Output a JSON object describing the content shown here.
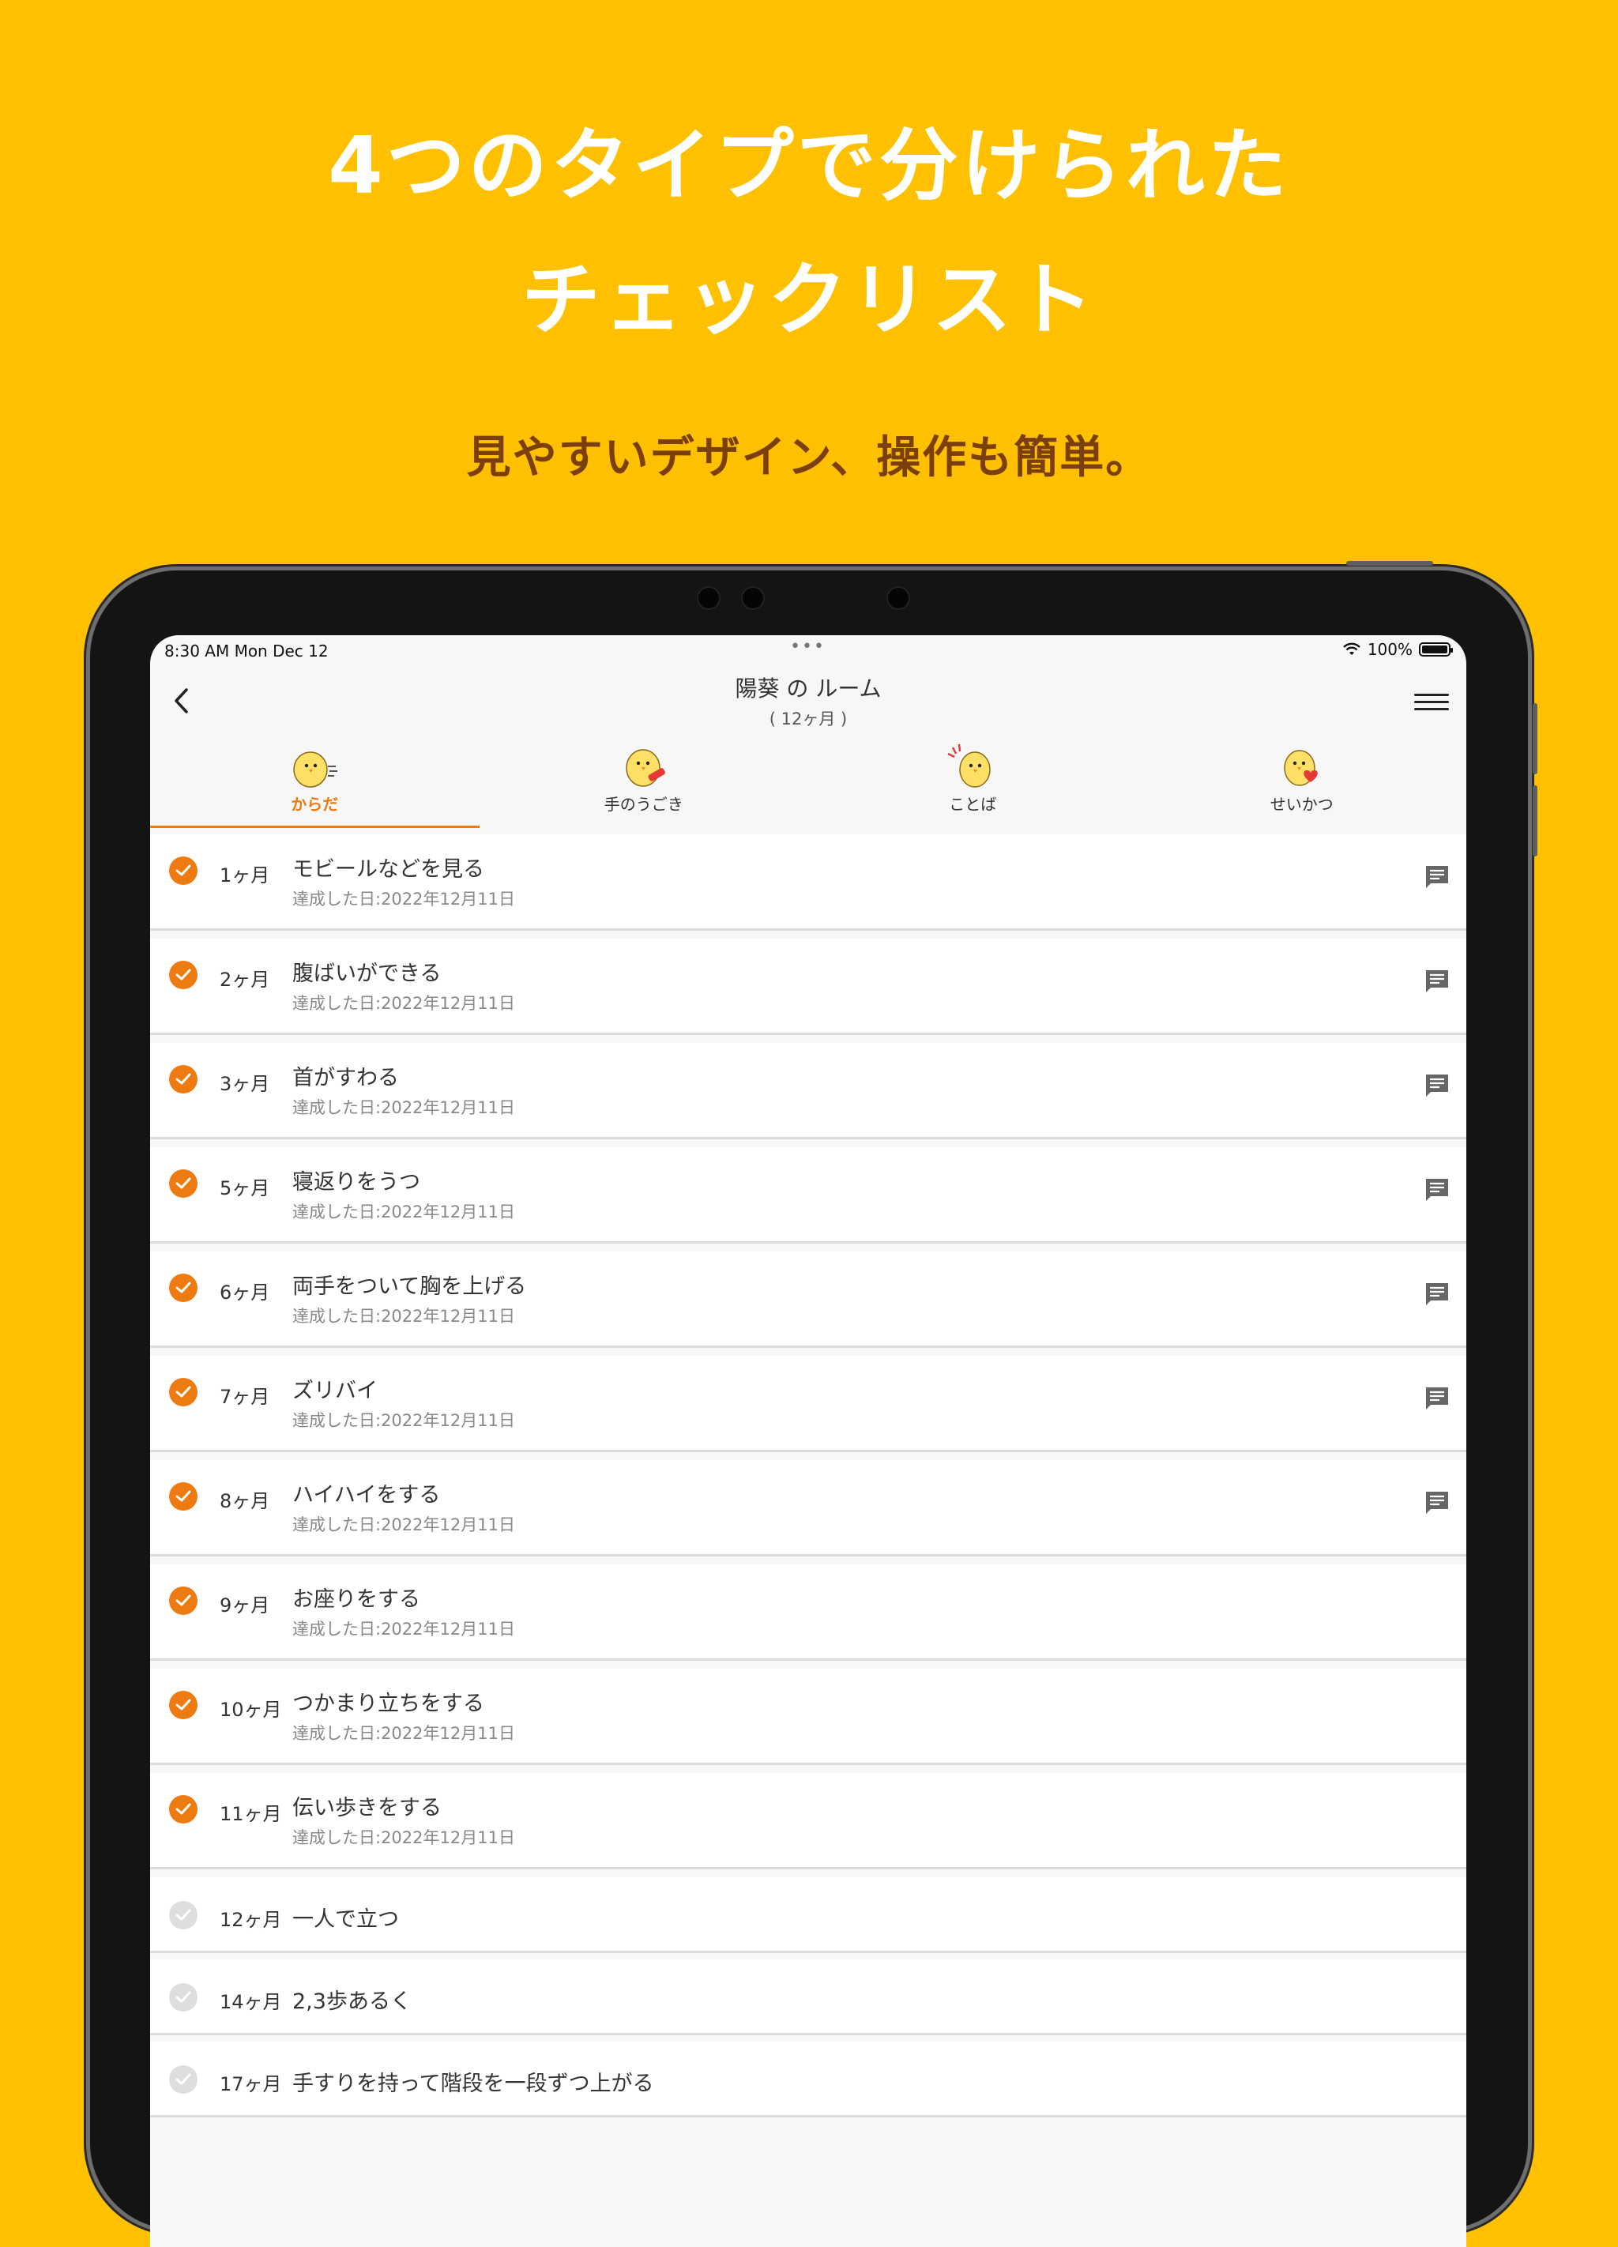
{
  "promo": {
    "headline_line1": "4つのタイプで分けられた",
    "headline_line2": "チェックリスト",
    "subline": "見やすいデザイン、操作も簡単。"
  },
  "status_bar": {
    "time": "8:30 AM   Mon Dec 12",
    "dots": "•••",
    "battery": "100%"
  },
  "nav": {
    "title": "陽葵 の ルーム",
    "subtitle": "( 12ヶ月 )",
    "back_icon": "chevron-left-icon",
    "menu_icon": "hamburger-menu-icon"
  },
  "tabs": [
    {
      "label": "からだ",
      "active": true
    },
    {
      "label": "手のうごき",
      "active": false
    },
    {
      "label": "ことば",
      "active": false
    },
    {
      "label": "せいかつ",
      "active": false
    }
  ],
  "milestones": [
    {
      "age": "1ヶ月",
      "title": "モビールなどを見る",
      "date": "達成した日:2022年12月11日",
      "done": true,
      "comment": true
    },
    {
      "age": "2ヶ月",
      "title": "腹ばいができる",
      "date": "達成した日:2022年12月11日",
      "done": true,
      "comment": true
    },
    {
      "age": "3ヶ月",
      "title": "首がすわる",
      "date": "達成した日:2022年12月11日",
      "done": true,
      "comment": true
    },
    {
      "age": "5ヶ月",
      "title": "寝返りをうつ",
      "date": "達成した日:2022年12月11日",
      "done": true,
      "comment": true
    },
    {
      "age": "6ヶ月",
      "title": "両手をついて胸を上げる",
      "date": "達成した日:2022年12月11日",
      "done": true,
      "comment": true
    },
    {
      "age": "7ヶ月",
      "title": "ズリバイ",
      "date": "達成した日:2022年12月11日",
      "done": true,
      "comment": true
    },
    {
      "age": "8ヶ月",
      "title": "ハイハイをする",
      "date": "達成した日:2022年12月11日",
      "done": true,
      "comment": true
    },
    {
      "age": "9ヶ月",
      "title": "お座りをする",
      "date": "達成した日:2022年12月11日",
      "done": true,
      "comment": false
    },
    {
      "age": "10ヶ月",
      "title": "つかまり立ちをする",
      "date": "達成した日:2022年12月11日",
      "done": true,
      "comment": false
    },
    {
      "age": "11ヶ月",
      "title": "伝い歩きをする",
      "date": "達成した日:2022年12月11日",
      "done": true,
      "comment": false
    },
    {
      "age": "12ヶ月",
      "title": "一人で立つ",
      "date": "",
      "done": false,
      "comment": false
    },
    {
      "age": "14ヶ月",
      "title": "2,3歩あるく",
      "date": "",
      "done": false,
      "comment": false
    },
    {
      "age": "17ヶ月",
      "title": "手すりを持って階段を一段ずつ上がる",
      "date": "",
      "done": false,
      "comment": false
    }
  ],
  "colors": {
    "background": "#FFC000",
    "accent": "#EE7A12",
    "subline": "#7A3F0A"
  }
}
